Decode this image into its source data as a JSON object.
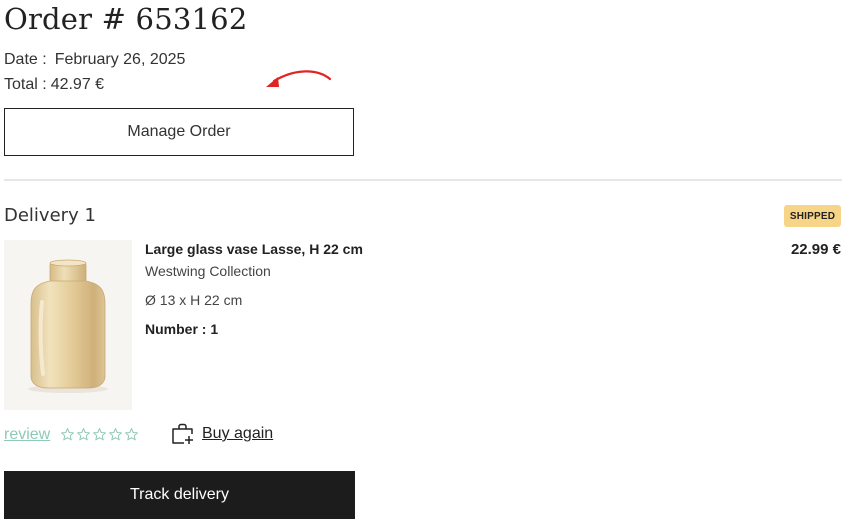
{
  "order": {
    "title": "Order # 653162",
    "date_label": "Date :",
    "date_value": "February 26, 2025",
    "total_label": "Total :",
    "total_value": "42.97 €"
  },
  "manage_button_label": "Manage Order",
  "delivery": {
    "title": "Delivery 1",
    "status": "SHIPPED",
    "status_color": "#f7d588"
  },
  "product": {
    "name": "Large glass vase Lasse, H 22 cm",
    "brand": "Westwing Collection",
    "dimensions": "Ø 13 x H 22 cm",
    "quantity": "Number : 1",
    "price": "22.99 €",
    "image_icon": "glass-vase-image"
  },
  "review": {
    "label": "review",
    "star_count": 5,
    "rating": 0,
    "star_icon": "star-outline-icon",
    "color": "#8fc9b8"
  },
  "buy_again": {
    "label": "Buy again",
    "icon": "bag-plus-icon"
  },
  "track_button_label": "Track delivery",
  "annotation": {
    "icon": "red-curved-arrow-icon",
    "color": "#e02424"
  }
}
